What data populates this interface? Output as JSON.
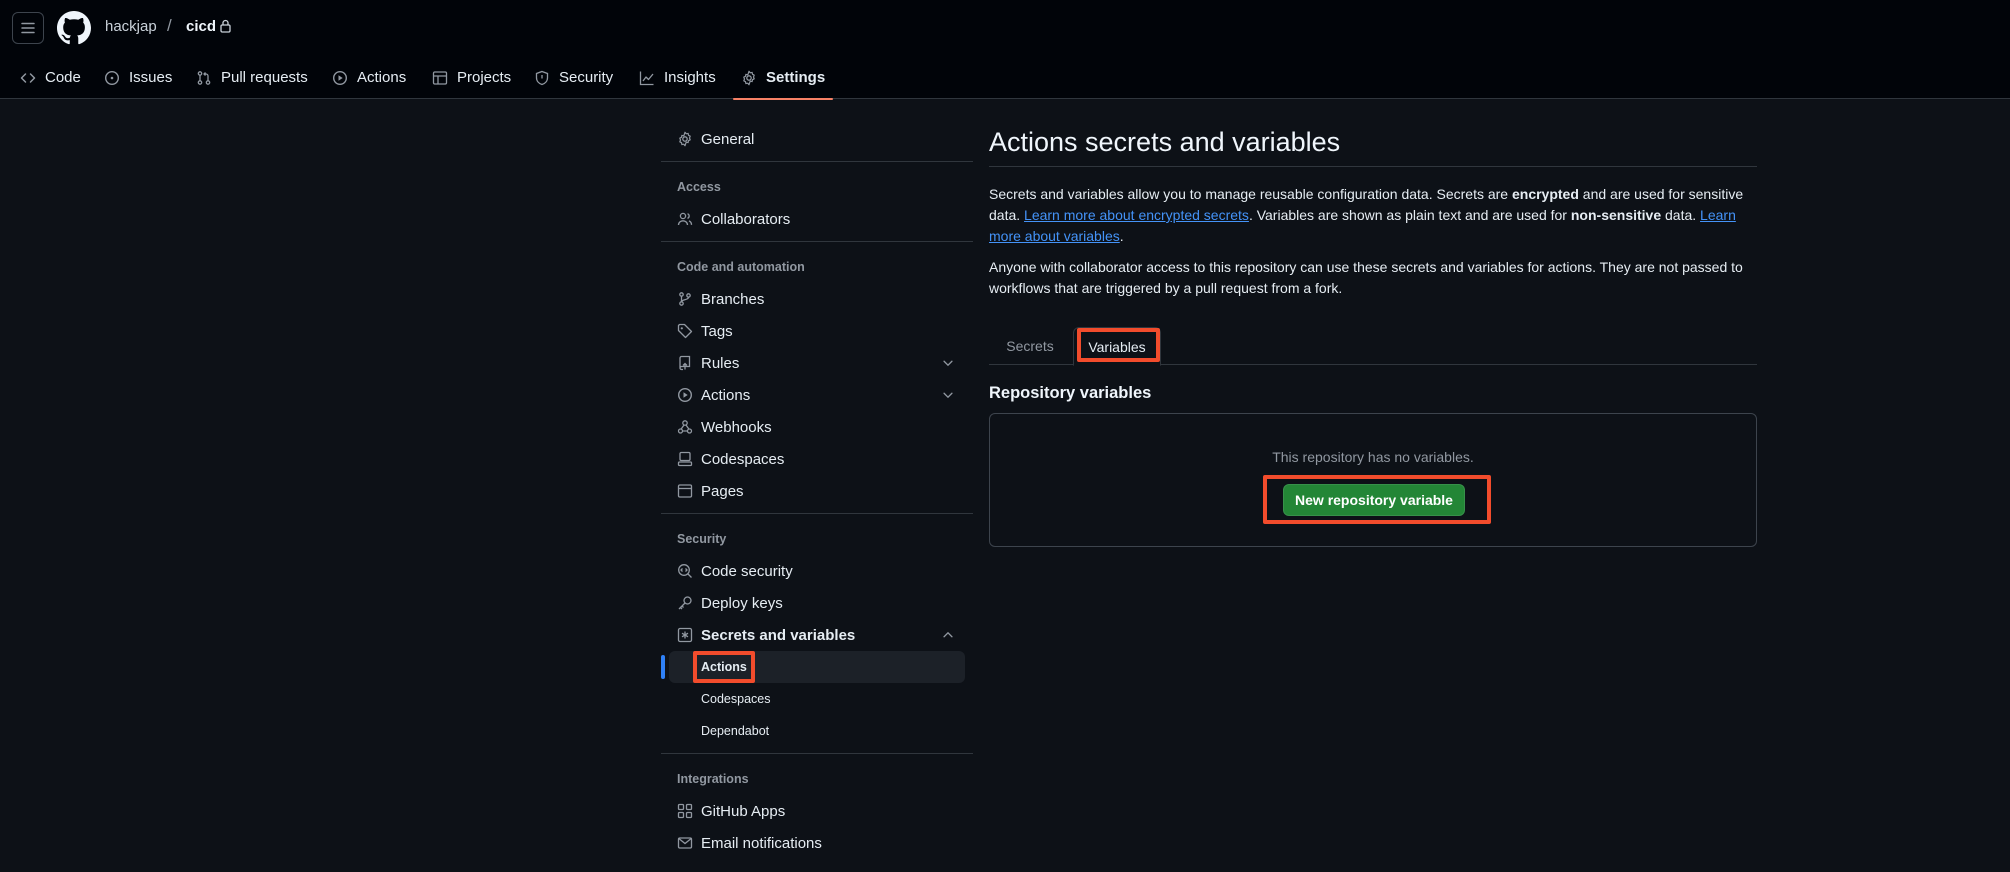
{
  "header": {
    "owner": "hackjap",
    "separator": "/",
    "repo": "cicd"
  },
  "repo_tabs": [
    {
      "label": "Code",
      "icon": "code-icon"
    },
    {
      "label": "Issues",
      "icon": "issue-opened-icon"
    },
    {
      "label": "Pull requests",
      "icon": "git-pull-request-icon"
    },
    {
      "label": "Actions",
      "icon": "play-icon"
    },
    {
      "label": "Projects",
      "icon": "table-icon"
    },
    {
      "label": "Security",
      "icon": "shield-icon"
    },
    {
      "label": "Insights",
      "icon": "graph-icon"
    },
    {
      "label": "Settings",
      "icon": "gear-icon",
      "active": true
    }
  ],
  "sidebar": {
    "general": "General",
    "group_access": "Access",
    "collaborators": "Collaborators",
    "group_code": "Code and automation",
    "branches": "Branches",
    "tags": "Tags",
    "rules": "Rules",
    "actions": "Actions",
    "webhooks": "Webhooks",
    "codespaces": "Codespaces",
    "pages": "Pages",
    "group_security": "Security",
    "code_security": "Code security",
    "deploy_keys": "Deploy keys",
    "secrets_and_variables": "Secrets and variables",
    "sub_actions": "Actions",
    "sub_codespaces": "Codespaces",
    "sub_dependabot": "Dependabot",
    "group_integrations": "Integrations",
    "github_apps": "GitHub Apps",
    "email_notifications": "Email notifications"
  },
  "main": {
    "title": "Actions secrets and variables",
    "intro_1": "Secrets and variables allow you to manage reusable configuration data. Secrets are ",
    "intro_encrypted": "encrypted",
    "intro_2": " and are used for sensitive data. ",
    "intro_link_secrets": "Learn more about encrypted secrets",
    "intro_3": ". Variables are shown as plain text and are used for ",
    "intro_nonsensitive": "non-sensitive",
    "intro_4": " data. ",
    "intro_link_variables": "Learn more about variables",
    "intro_5": ".",
    "access_note": "Anyone with collaborator access to this repository can use these secrets and variables for actions. They are not passed to workflows that are triggered by a pull request from a fork.",
    "tab_secrets": "Secrets",
    "tab_variables": "Variables",
    "section_title": "Repository variables",
    "empty_text": "This repository has no variables.",
    "new_button": "New repository variable"
  },
  "colors": {
    "background": "#0d1117",
    "header": "#010409",
    "accent_tab": "#f78166",
    "link": "#4493f8",
    "primary_button": "#238636",
    "highlight": "#f24c2c"
  }
}
